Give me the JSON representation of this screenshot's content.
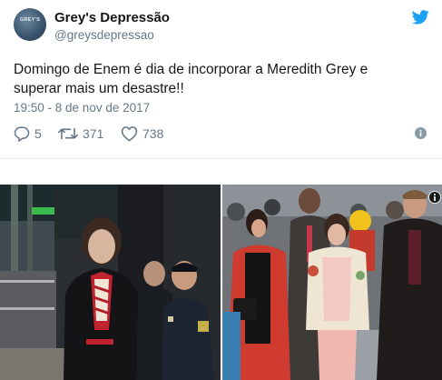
{
  "tweet": {
    "display_name": "Grey's Depressão",
    "handle": "@greysdepressao",
    "avatar_text": "GREY'S",
    "text": "Domingo de Enem é dia de incorporar a Meredith Grey e superar mais um desastre!!",
    "timestamp": "19:50 - 8 de nov de 2017"
  },
  "actions": {
    "replies": "5",
    "retweets": "371",
    "likes": "738"
  },
  "icons": [
    "twitter-bird-icon",
    "reply-icon",
    "retweet-icon",
    "heart-icon",
    "info-icon"
  ],
  "colors": {
    "twitter_blue": "#1da1f2",
    "secondary_text": "#657786",
    "primary_text": "#14171a"
  }
}
